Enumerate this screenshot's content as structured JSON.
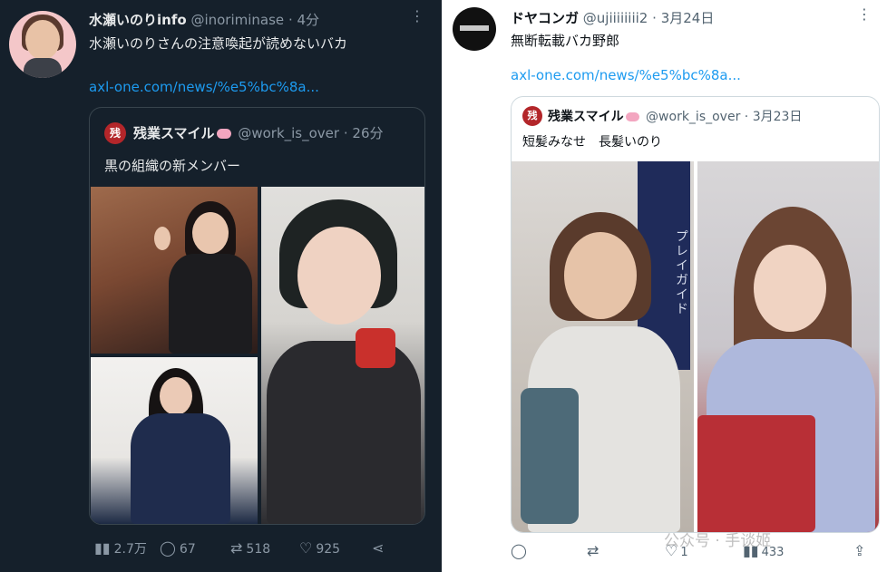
{
  "left_tweet": {
    "author_name": "水瀬いのりinfo",
    "author_handle": "@inoriminase",
    "separator": "·",
    "time": "4分",
    "more_icon": "more-icon",
    "text": "水瀬いのりさんの注意喚起が読めないバカ",
    "link": "axl-one.com/news/%e5%bc%8a...",
    "quote": {
      "icon_label": "残",
      "author_name": "残業スマイル",
      "author_handle": "@work_is_over",
      "separator": "·",
      "time": "26分",
      "text": "黒の組織の新メンバー"
    },
    "stats": {
      "views": "2.7万",
      "replies": "67",
      "retweets": "518",
      "likes": "925"
    }
  },
  "right_tweet": {
    "author_name": "ドヤコンガ",
    "author_handle": "@ujiiiiiiii2",
    "separator": "·",
    "time": "3月24日",
    "text": "無断転載バカ野郎",
    "link": "axl-one.com/news/%e5%bc%8a...",
    "quote": {
      "icon_label": "残",
      "author_name": "残業スマイル",
      "author_handle": "@work_is_over",
      "separator": "·",
      "time": "3月23日",
      "text": "短髪みなせ　長髪いのり",
      "poster_text": "プレイガイド"
    },
    "stats": {
      "likes": "1",
      "views": "433"
    },
    "watermark": "公众号 · 手谈姬"
  },
  "colors": {
    "dark_bg": "#15202b",
    "link_blue": "#1d9bf0",
    "badge_red": "#b3262a"
  }
}
